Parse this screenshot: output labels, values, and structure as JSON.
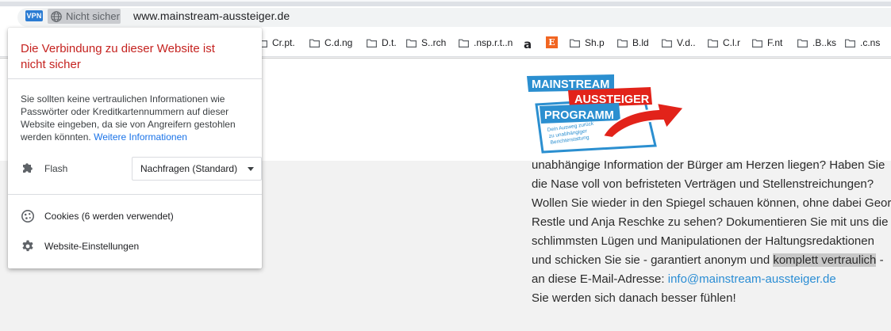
{
  "browser": {
    "vpn_label": "VPN",
    "security_text": "Nicht sicher",
    "url": "www.mainstream-aussteiger.de"
  },
  "bookmarks": [
    {
      "label": "Cr.pt.",
      "icon": "folder-icon"
    },
    {
      "label": "C.d.ng",
      "icon": "folder-icon"
    },
    {
      "label": "D.t.",
      "icon": "folder-icon"
    },
    {
      "label": "S..rch",
      "icon": "folder-icon"
    },
    {
      "label": ".nsp.r.t..n",
      "icon": "folder-icon"
    },
    {
      "label": "",
      "icon": "amazon-icon"
    },
    {
      "label": "",
      "icon": "etsy-icon"
    },
    {
      "label": "Sh.p",
      "icon": "folder-icon"
    },
    {
      "label": "B.ld",
      "icon": "folder-icon"
    },
    {
      "label": "V.d..",
      "icon": "folder-icon"
    },
    {
      "label": "C.l.r",
      "icon": "folder-icon"
    },
    {
      "label": "F.nt",
      "icon": "folder-icon"
    },
    {
      "label": ".B..ks",
      "icon": "folder-icon"
    },
    {
      "label": ".c.ns",
      "icon": "folder-icon"
    }
  ],
  "logo": {
    "line1": "MAINSTREAM",
    "line2": "AUSSTEIGER",
    "line3": "PROGRAMM",
    "tagline": [
      "Dein Ausweg zurück",
      "zu unabhängiger",
      "Berichterstattung"
    ],
    "colors": {
      "blue": "#2b8fd0",
      "red": "#e2231a"
    }
  },
  "article": {
    "line1": "unabhängige Information der Bürger am Herzen liegen? Haben Sie",
    "line2": "die Nase voll von befristeten Verträgen und Stellenstreichungen?",
    "line3": "Wollen Sie wieder in den Spiegel schauen können, ohne dabei Georg",
    "line4": "Restle und Anja Reschke zu sehen? Dokumentieren Sie mit uns die",
    "line5": "schlimmsten Lügen und Manipulationen der Haltungsredaktionen",
    "line6_pre": "und schicken Sie sie - garantiert anonym und ",
    "line6_highlight": "komplett vertraulich",
    "line6_post": " -",
    "line7_pre": "an diese E-Mail-Adresse: ",
    "email": "info@mainstream-aussteiger.de",
    "line8": "Sie werden sich danach besser fühlen!"
  },
  "popup": {
    "title": "Die Verbindung zu dieser Website ist nicht sicher",
    "body": "Sie sollten keine vertraulichen Informationen wie Passwörter oder Kreditkartennummern auf dieser Website eingeben, da sie von Angreifern gestohlen werden könnten.",
    "more_link": "Weitere Informationen",
    "flash_label": "Flash",
    "flash_value": "Nachfragen (Standard)",
    "cookies": "Cookies (6 werden verwendet)",
    "site_settings": "Website-Einstellungen",
    "title_color": "#c5221f"
  }
}
